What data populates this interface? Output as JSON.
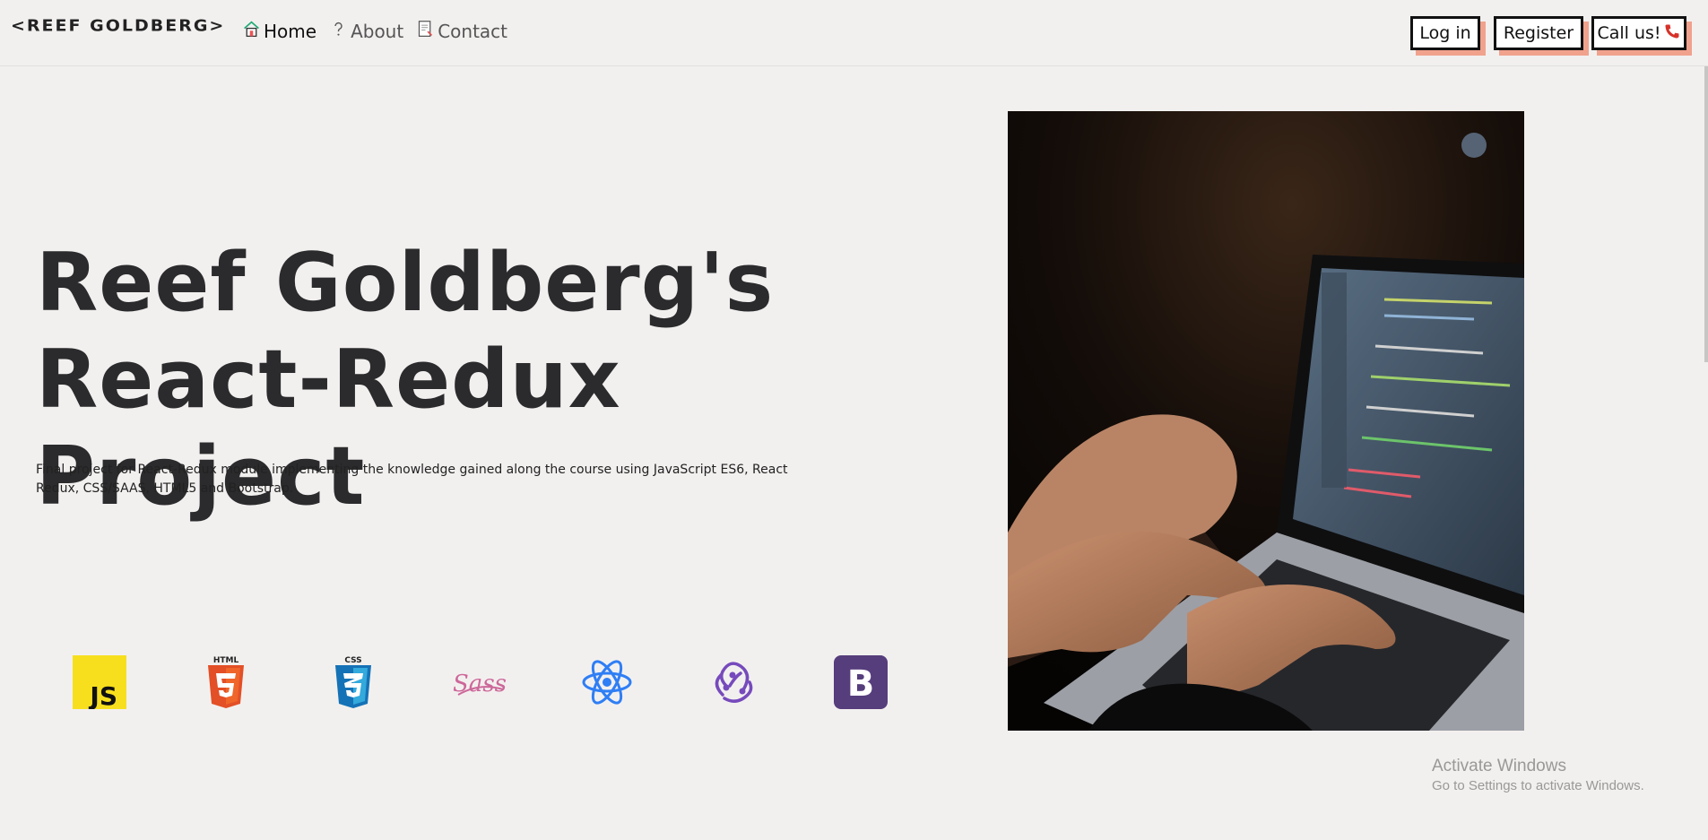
{
  "navbar": {
    "brand": "<REEF GOLDBERG>",
    "links": [
      {
        "label": "Home",
        "icon": "home-icon"
      },
      {
        "label": "About",
        "icon": "question-icon"
      },
      {
        "label": "Contact",
        "icon": "contact-icon"
      }
    ],
    "login_label": "Log in",
    "register_label": "Register",
    "call_label": "Call us!",
    "call_icon": "phone-icon",
    "button_shadow_color": "#f0a28d"
  },
  "hero": {
    "title_line1": "Reef Goldberg's",
    "title_line2": "React-Redux Project",
    "description": "Final project for React-Redux module implementing the knowledge gained along the course using JavaScript ES6, React Redux, CSS/SAAS, HTML5 and Bootstrap."
  },
  "tech_icons": [
    {
      "name": "javascript-logo",
      "text": "JS"
    },
    {
      "name": "html5-logo",
      "text": "HTML"
    },
    {
      "name": "css3-logo",
      "text": "CSS"
    },
    {
      "name": "sass-logo",
      "text": "Sass"
    },
    {
      "name": "react-logo"
    },
    {
      "name": "redux-logo"
    },
    {
      "name": "bootstrap-logo",
      "text": "B"
    }
  ],
  "photo": {
    "subject": "hands typing on a laptop with code on screen"
  },
  "watermark": {
    "line1": "Activate Windows",
    "line2": "Go to Settings to activate Windows."
  },
  "colors": {
    "background": "#f2f0ef",
    "title": "#2b2b2d",
    "accent_shadow": "#f0a28d",
    "js": "#f7df1e",
    "html5": "#e34f26",
    "css3": "#1572b6",
    "sass": "#cd6799",
    "react": "#2f7ef5",
    "redux": "#764abc",
    "bootstrap": "#563d7c"
  }
}
